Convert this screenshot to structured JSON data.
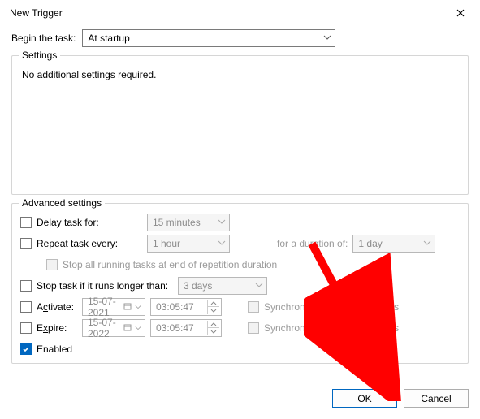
{
  "window": {
    "title": "New Trigger"
  },
  "begin": {
    "label": "Begin the task:",
    "value": "At startup"
  },
  "settings_group": {
    "legend": "Settings",
    "message": "No additional settings required."
  },
  "advanced": {
    "legend": "Advanced settings",
    "delay": {
      "label": "Delay task for:",
      "value": "15 minutes",
      "checked": false
    },
    "repeat": {
      "label": "Repeat task every:",
      "value": "1 hour",
      "checked": false,
      "duration_label": "for a duration of:",
      "duration_value": "1 day",
      "stop_all_label": "Stop all running tasks at end of repetition duration"
    },
    "stop_longer": {
      "label": "Stop task if it runs longer than:",
      "value": "3 days",
      "checked": false
    },
    "activate": {
      "label_pre": "A",
      "label_u": "c",
      "label_post": "tivate:",
      "date": "15-07-2021",
      "time": "03:05:47",
      "sync_label": "Synchronize across time zones",
      "checked": false
    },
    "expire": {
      "label_pre": "E",
      "label_u": "x",
      "label_post": "pire:",
      "date": "15-07-2022",
      "time": "03:05:47",
      "sync_label": "Synchronize across time zones",
      "checked": false
    },
    "enabled": {
      "label": "Enabled",
      "checked": true
    }
  },
  "buttons": {
    "ok": "OK",
    "cancel": "Cancel"
  }
}
